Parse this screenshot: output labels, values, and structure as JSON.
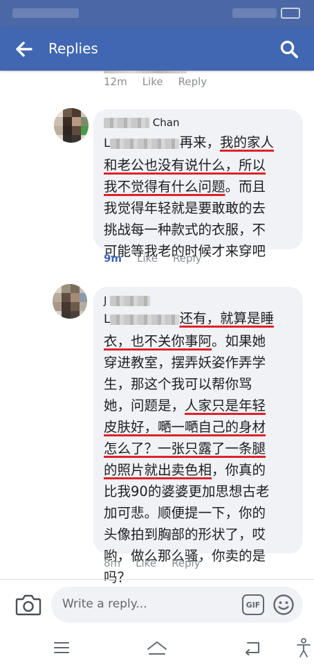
{
  "header": {
    "title": "Replies"
  },
  "top_reply": {
    "time": "12m",
    "like_label": "Like",
    "reply_label": "Reply"
  },
  "comments": [
    {
      "author_suffix": "Chan",
      "lines": [
        [
          {
            "t": "再来，",
            "u": false
          },
          {
            "t": "我的家人",
            "u": true
          }
        ],
        [
          {
            "t": "和老公也没有说什么，所以",
            "u": true
          }
        ],
        [
          {
            "t": "我不觉得有什么问题",
            "u": true
          },
          {
            "t": "。而且",
            "u": false
          }
        ],
        [
          {
            "t": "我觉得年轻就是要敢敢的去",
            "u": false
          }
        ],
        [
          {
            "t": "挑战每一种款式的衣服，不",
            "u": false
          }
        ],
        [
          {
            "t": "可能等我老的时候才来穿吧",
            "u": false
          }
        ]
      ],
      "time": "9m",
      "like_label": "Like",
      "reply_label": "Reply"
    },
    {
      "author_prefix": "J",
      "lines": [
        [
          {
            "t": "还有，就算是睡",
            "u": true
          }
        ],
        [
          {
            "t": "衣，也不关你事阿",
            "u": true
          },
          {
            "t": "。如果她",
            "u": false
          }
        ],
        [
          {
            "t": "穿进教室，摆弄妖姿作弄学",
            "u": false
          }
        ],
        [
          {
            "t": "生，那这个我可以帮你骂",
            "u": false
          }
        ],
        [
          {
            "t": "她，问题是，",
            "u": false
          },
          {
            "t": "人家只是年轻",
            "u": true
          }
        ],
        [
          {
            "t": "皮肤好，嗮一嗮自己的身材",
            "u": true
          }
        ],
        [
          {
            "t": "怎么了？一张只露了一条腿",
            "u": true
          }
        ],
        [
          {
            "t": "的照片就出卖色相",
            "u": true
          },
          {
            "t": "，你真的",
            "u": false
          }
        ],
        [
          {
            "t": "比我90的婆婆更加思想古老",
            "u": false
          }
        ],
        [
          {
            "t": "加可悲。顺便提一下，你的",
            "u": false
          }
        ],
        [
          {
            "t": "头像拍到胸部的形状了，哎",
            "u": false
          }
        ],
        [
          {
            "t": "哟，做么那么骚，你卖的是",
            "u": false
          }
        ],
        [
          {
            "t": "吗？",
            "u": false
          }
        ]
      ],
      "time": "8m",
      "like_label": "Like",
      "reply_label": "Reply"
    }
  ],
  "composer": {
    "placeholder": "Write a reply...",
    "gif_label": "GIF"
  },
  "colors": {
    "brand": "#4267b2",
    "underline": "#e0202a",
    "bubble": "#f0f2f5"
  }
}
